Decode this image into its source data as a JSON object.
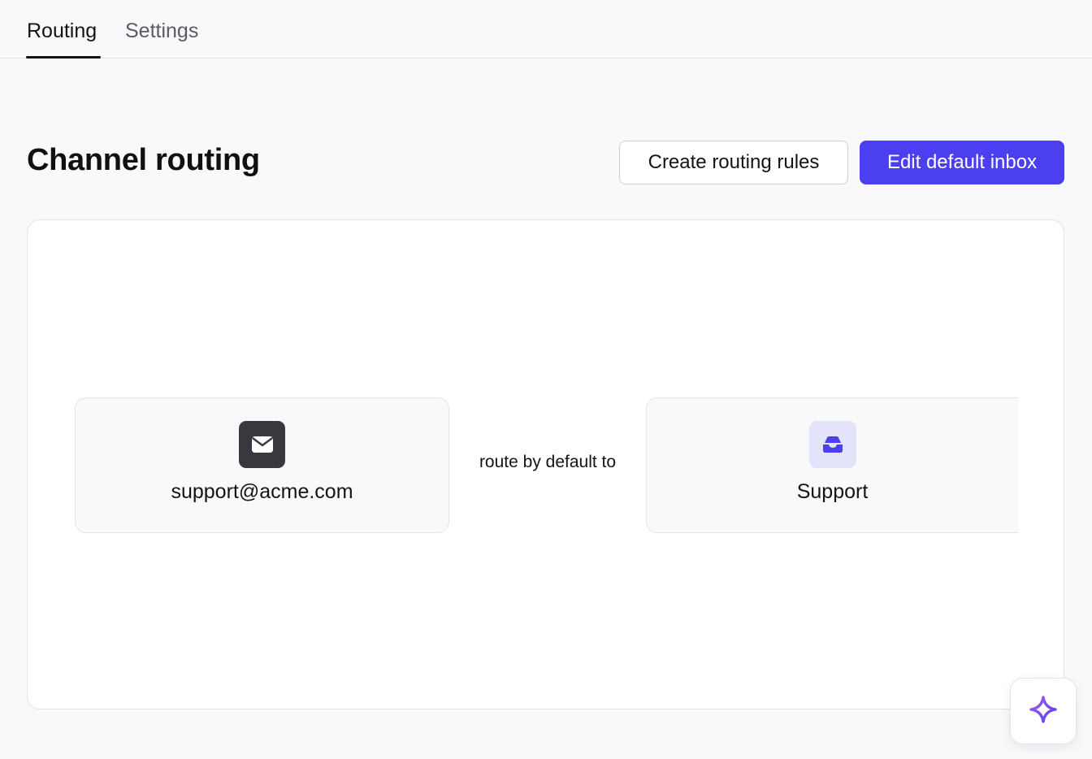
{
  "tabs": [
    {
      "label": "Routing",
      "active": true
    },
    {
      "label": "Settings",
      "active": false
    }
  ],
  "page": {
    "title": "Channel routing",
    "create_rules_label": "Create routing rules",
    "edit_inbox_label": "Edit default inbox"
  },
  "routing": {
    "source": {
      "label": "support@acme.com",
      "icon": "mail-icon"
    },
    "connector_text": "route by default to",
    "destination": {
      "label": "Support",
      "icon": "inbox-icon"
    }
  },
  "colors": {
    "primary": "#4b3ff0",
    "fab_accent": "#7b3ff0"
  },
  "fab": {
    "icon": "sparkle-icon"
  }
}
